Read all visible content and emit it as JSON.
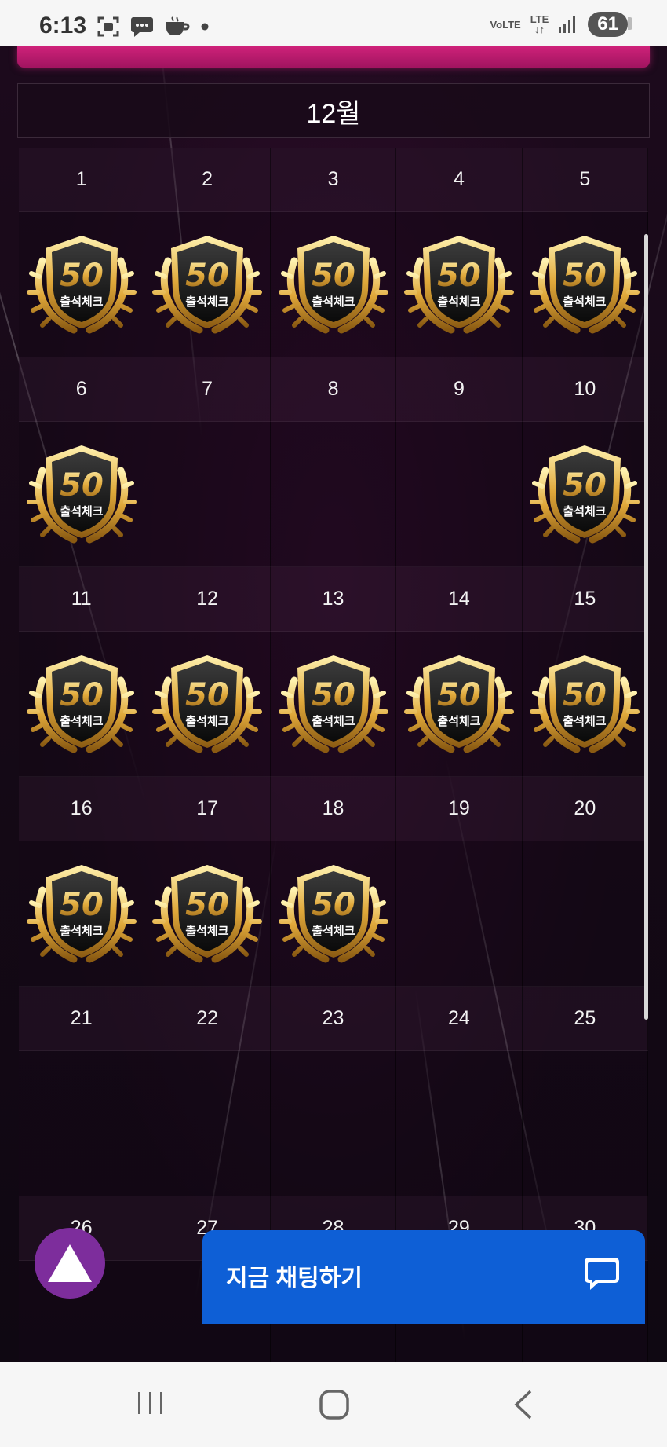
{
  "status_bar": {
    "time": "6:13",
    "network_volte": "VoLTE",
    "network_lte": "LTE",
    "battery": "61",
    "icons": [
      "screenshot-icon",
      "chat-bubble-icon",
      "coffee-icon",
      "dot-icon",
      "signal-icon"
    ]
  },
  "calendar": {
    "month_title": "12월",
    "badge_number": "50",
    "badge_label": "출석체크",
    "weeks": [
      {
        "days": [
          "1",
          "2",
          "3",
          "4",
          "5"
        ],
        "stamped": [
          true,
          true,
          true,
          true,
          true
        ]
      },
      {
        "days": [
          "6",
          "7",
          "8",
          "9",
          "10"
        ],
        "stamped": [
          true,
          false,
          false,
          false,
          true
        ]
      },
      {
        "days": [
          "11",
          "12",
          "13",
          "14",
          "15"
        ],
        "stamped": [
          true,
          true,
          true,
          true,
          true
        ]
      },
      {
        "days": [
          "16",
          "17",
          "18",
          "19",
          "20"
        ],
        "stamped": [
          true,
          true,
          true,
          false,
          false
        ]
      },
      {
        "days": [
          "21",
          "22",
          "23",
          "24",
          "25"
        ],
        "stamped": [
          false,
          false,
          false,
          false,
          false
        ]
      },
      {
        "days": [
          "26",
          "27",
          "28",
          "29",
          "30"
        ],
        "stamped": [
          false,
          false,
          false,
          false,
          false
        ]
      }
    ]
  },
  "chat": {
    "label": "지금 채팅하기"
  },
  "colors": {
    "accent_pink": "#c81c72",
    "chat_blue": "#0e5fd6",
    "top_button_purple": "#7d2d9c",
    "gold": "#e0a83a"
  },
  "nav": {
    "icons": [
      "recent-apps-icon",
      "home-icon",
      "back-icon"
    ]
  }
}
